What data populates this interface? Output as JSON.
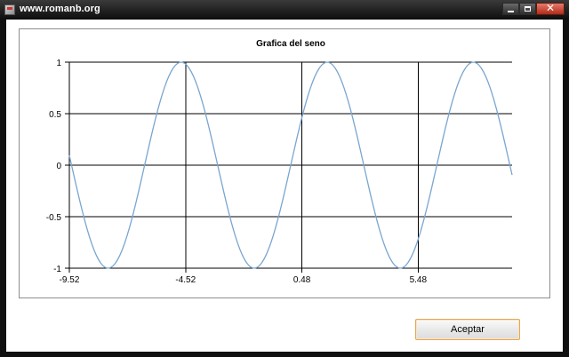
{
  "window": {
    "title": "www.romanb.org",
    "accent": "#e2a85b"
  },
  "button": {
    "accept_label": "Aceptar"
  },
  "chart_data": {
    "type": "line",
    "title": "Grafica del seno",
    "xlabel": "",
    "ylabel": "",
    "function": "sin(x)",
    "xlim": [
      -9.52,
      9.52
    ],
    "ylim": [
      -1,
      1
    ],
    "x_ticks": [
      -9.52,
      -4.52,
      0.48,
      5.48
    ],
    "x_tick_labels": [
      "-9.52",
      "-4.52",
      "0.48",
      "5.48"
    ],
    "y_ticks": [
      1,
      0.5,
      0,
      -0.5,
      -1
    ],
    "y_tick_labels": [
      "1",
      "0.5",
      "0",
      "-0.5",
      "-1"
    ],
    "grid": true,
    "line_color": "#7aa6cf",
    "series": [
      {
        "values_note": "",
        "x_start": -9.52,
        "x_end": 9.52,
        "samples": 200
      }
    ]
  }
}
